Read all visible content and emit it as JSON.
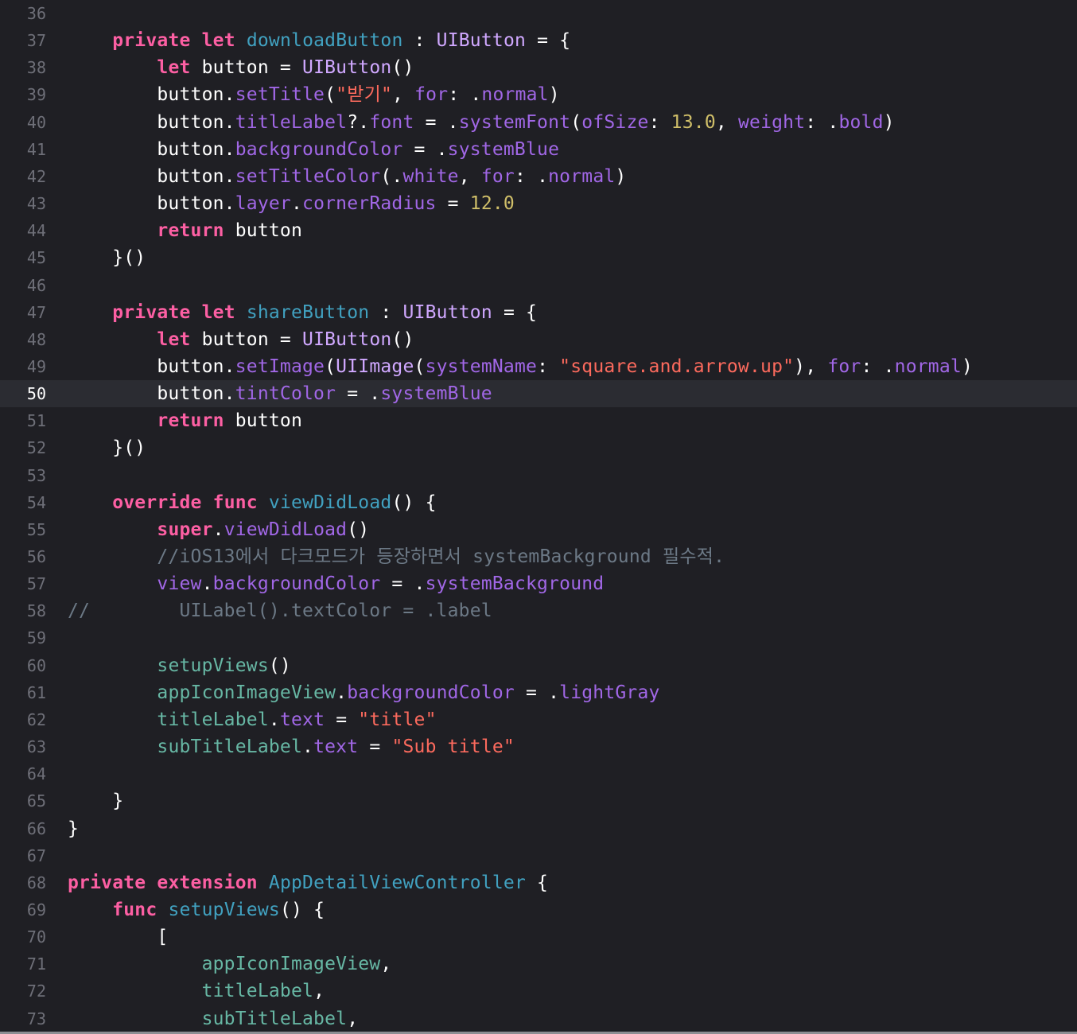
{
  "editor": {
    "current_line": 50,
    "lines": [
      {
        "n": "36",
        "t": [],
        "current": false
      },
      {
        "n": "37",
        "t": [
          [
            "    ",
            "plain"
          ],
          [
            "private",
            "kw"
          ],
          [
            " ",
            "plain"
          ],
          [
            "let",
            "kw"
          ],
          [
            " ",
            "plain"
          ],
          [
            "downloadButton",
            "decl"
          ],
          [
            " : ",
            "plain"
          ],
          [
            "UIButton",
            "type"
          ],
          [
            " = {",
            "plain"
          ]
        ],
        "current": false
      },
      {
        "n": "38",
        "t": [
          [
            "        ",
            "plain"
          ],
          [
            "let",
            "kw"
          ],
          [
            " button = ",
            "plain"
          ],
          [
            "UIButton",
            "type"
          ],
          [
            "()",
            "plain"
          ]
        ],
        "current": false
      },
      {
        "n": "39",
        "t": [
          [
            "        button.",
            "plain"
          ],
          [
            "setTitle",
            "prop"
          ],
          [
            "(",
            "plain"
          ],
          [
            "\"받기\"",
            "str"
          ],
          [
            ", ",
            "plain"
          ],
          [
            "for",
            "prop"
          ],
          [
            ": .",
            "plain"
          ],
          [
            "normal",
            "prop"
          ],
          [
            ")",
            "plain"
          ]
        ],
        "current": false
      },
      {
        "n": "40",
        "t": [
          [
            "        button.",
            "plain"
          ],
          [
            "titleLabel",
            "prop"
          ],
          [
            "?.",
            "plain"
          ],
          [
            "font",
            "prop"
          ],
          [
            " = .",
            "plain"
          ],
          [
            "systemFont",
            "prop"
          ],
          [
            "(",
            "plain"
          ],
          [
            "ofSize",
            "prop"
          ],
          [
            ": ",
            "plain"
          ],
          [
            "13.0",
            "num"
          ],
          [
            ", ",
            "plain"
          ],
          [
            "weight",
            "prop"
          ],
          [
            ": .",
            "plain"
          ],
          [
            "bold",
            "prop"
          ],
          [
            ")",
            "plain"
          ]
        ],
        "current": false
      },
      {
        "n": "41",
        "t": [
          [
            "        button.",
            "plain"
          ],
          [
            "backgroundColor",
            "prop"
          ],
          [
            " = .",
            "plain"
          ],
          [
            "systemBlue",
            "prop"
          ]
        ],
        "current": false
      },
      {
        "n": "42",
        "t": [
          [
            "        button.",
            "plain"
          ],
          [
            "setTitleColor",
            "prop"
          ],
          [
            "(.",
            "plain"
          ],
          [
            "white",
            "prop"
          ],
          [
            ", ",
            "plain"
          ],
          [
            "for",
            "prop"
          ],
          [
            ": .",
            "plain"
          ],
          [
            "normal",
            "prop"
          ],
          [
            ")",
            "plain"
          ]
        ],
        "current": false
      },
      {
        "n": "43",
        "t": [
          [
            "        button.",
            "plain"
          ],
          [
            "layer",
            "prop"
          ],
          [
            ".",
            "plain"
          ],
          [
            "cornerRadius",
            "prop"
          ],
          [
            " = ",
            "plain"
          ],
          [
            "12.0",
            "num"
          ]
        ],
        "current": false
      },
      {
        "n": "44",
        "t": [
          [
            "        ",
            "plain"
          ],
          [
            "return",
            "kw"
          ],
          [
            " button",
            "plain"
          ]
        ],
        "current": false
      },
      {
        "n": "45",
        "t": [
          [
            "    }()",
            "plain"
          ]
        ],
        "current": false
      },
      {
        "n": "46",
        "t": [],
        "current": false
      },
      {
        "n": "47",
        "t": [
          [
            "    ",
            "plain"
          ],
          [
            "private",
            "kw"
          ],
          [
            " ",
            "plain"
          ],
          [
            "let",
            "kw"
          ],
          [
            " ",
            "plain"
          ],
          [
            "shareButton",
            "decl"
          ],
          [
            " : ",
            "plain"
          ],
          [
            "UIButton",
            "type"
          ],
          [
            " = {",
            "plain"
          ]
        ],
        "current": false
      },
      {
        "n": "48",
        "t": [
          [
            "        ",
            "plain"
          ],
          [
            "let",
            "kw"
          ],
          [
            " button = ",
            "plain"
          ],
          [
            "UIButton",
            "type"
          ],
          [
            "()",
            "plain"
          ]
        ],
        "current": false
      },
      {
        "n": "49",
        "t": [
          [
            "        button.",
            "plain"
          ],
          [
            "setImage",
            "prop"
          ],
          [
            "(",
            "plain"
          ],
          [
            "UIImage",
            "type"
          ],
          [
            "(",
            "plain"
          ],
          [
            "systemName",
            "prop"
          ],
          [
            ": ",
            "plain"
          ],
          [
            "\"square.and.arrow.up\"",
            "str"
          ],
          [
            "), ",
            "plain"
          ],
          [
            "for",
            "prop"
          ],
          [
            ": .",
            "plain"
          ],
          [
            "normal",
            "prop"
          ],
          [
            ")",
            "plain"
          ]
        ],
        "current": false
      },
      {
        "n": "50",
        "t": [
          [
            "        button.",
            "plain"
          ],
          [
            "tintColor",
            "prop"
          ],
          [
            " = .",
            "plain"
          ],
          [
            "systemBlue",
            "prop"
          ]
        ],
        "current": true
      },
      {
        "n": "51",
        "t": [
          [
            "        ",
            "plain"
          ],
          [
            "return",
            "kw"
          ],
          [
            " button",
            "plain"
          ]
        ],
        "current": false
      },
      {
        "n": "52",
        "t": [
          [
            "    }()",
            "plain"
          ]
        ],
        "current": false
      },
      {
        "n": "53",
        "t": [],
        "current": false
      },
      {
        "n": "54",
        "t": [
          [
            "    ",
            "plain"
          ],
          [
            "override",
            "kw"
          ],
          [
            " ",
            "plain"
          ],
          [
            "func",
            "kw"
          ],
          [
            " ",
            "plain"
          ],
          [
            "viewDidLoad",
            "decl"
          ],
          [
            "() {",
            "plain"
          ]
        ],
        "current": false
      },
      {
        "n": "55",
        "t": [
          [
            "        ",
            "plain"
          ],
          [
            "super",
            "kw"
          ],
          [
            ".",
            "plain"
          ],
          [
            "viewDidLoad",
            "prop"
          ],
          [
            "()",
            "plain"
          ]
        ],
        "current": false
      },
      {
        "n": "56",
        "t": [
          [
            "        ",
            "plain"
          ],
          [
            "//iOS13에서 다크모드가 등장하면서 systemBackground 필수적.",
            "com"
          ]
        ],
        "current": false
      },
      {
        "n": "57",
        "t": [
          [
            "        ",
            "plain"
          ],
          [
            "view",
            "prop"
          ],
          [
            ".",
            "plain"
          ],
          [
            "backgroundColor",
            "prop"
          ],
          [
            " = .",
            "plain"
          ],
          [
            "systemBackground",
            "prop"
          ]
        ],
        "current": false
      },
      {
        "n": "58",
        "t": [
          [
            "//        UILabel().textColor = .label",
            "com"
          ]
        ],
        "current": false
      },
      {
        "n": "59",
        "t": [],
        "current": false
      },
      {
        "n": "60",
        "t": [
          [
            "        ",
            "plain"
          ],
          [
            "setupViews",
            "proj"
          ],
          [
            "()",
            "plain"
          ]
        ],
        "current": false
      },
      {
        "n": "61",
        "t": [
          [
            "        ",
            "plain"
          ],
          [
            "appIconImageView",
            "proj"
          ],
          [
            ".",
            "plain"
          ],
          [
            "backgroundColor",
            "prop"
          ],
          [
            " = .",
            "plain"
          ],
          [
            "lightGray",
            "prop"
          ]
        ],
        "current": false
      },
      {
        "n": "62",
        "t": [
          [
            "        ",
            "plain"
          ],
          [
            "titleLabel",
            "proj"
          ],
          [
            ".",
            "plain"
          ],
          [
            "text",
            "prop"
          ],
          [
            " = ",
            "plain"
          ],
          [
            "\"title\"",
            "str"
          ]
        ],
        "current": false
      },
      {
        "n": "63",
        "t": [
          [
            "        ",
            "plain"
          ],
          [
            "subTitleLabel",
            "proj"
          ],
          [
            ".",
            "plain"
          ],
          [
            "text",
            "prop"
          ],
          [
            " = ",
            "plain"
          ],
          [
            "\"Sub title\"",
            "str"
          ]
        ],
        "current": false
      },
      {
        "n": "64",
        "t": [],
        "current": false
      },
      {
        "n": "65",
        "t": [
          [
            "    }",
            "plain"
          ]
        ],
        "current": false
      },
      {
        "n": "66",
        "t": [
          [
            "}",
            "plain"
          ]
        ],
        "current": false
      },
      {
        "n": "67",
        "t": [],
        "current": false
      },
      {
        "n": "68",
        "t": [
          [
            "private",
            "kw"
          ],
          [
            " ",
            "plain"
          ],
          [
            "extension",
            "kw"
          ],
          [
            " ",
            "plain"
          ],
          [
            "AppDetailViewController",
            "decl"
          ],
          [
            " {",
            "plain"
          ]
        ],
        "current": false
      },
      {
        "n": "69",
        "t": [
          [
            "    ",
            "plain"
          ],
          [
            "func",
            "kw"
          ],
          [
            " ",
            "plain"
          ],
          [
            "setupViews",
            "decl"
          ],
          [
            "() {",
            "plain"
          ]
        ],
        "current": false
      },
      {
        "n": "70",
        "t": [
          [
            "        [",
            "plain"
          ]
        ],
        "current": false
      },
      {
        "n": "71",
        "t": [
          [
            "            ",
            "plain"
          ],
          [
            "appIconImageView",
            "proj"
          ],
          [
            ",",
            "plain"
          ]
        ],
        "current": false
      },
      {
        "n": "72",
        "t": [
          [
            "            ",
            "plain"
          ],
          [
            "titleLabel",
            "proj"
          ],
          [
            ",",
            "plain"
          ]
        ],
        "current": false
      },
      {
        "n": "73",
        "t": [
          [
            "            ",
            "plain"
          ],
          [
            "subTitleLabel",
            "proj"
          ],
          [
            ",",
            "plain"
          ]
        ],
        "current": false
      }
    ]
  }
}
